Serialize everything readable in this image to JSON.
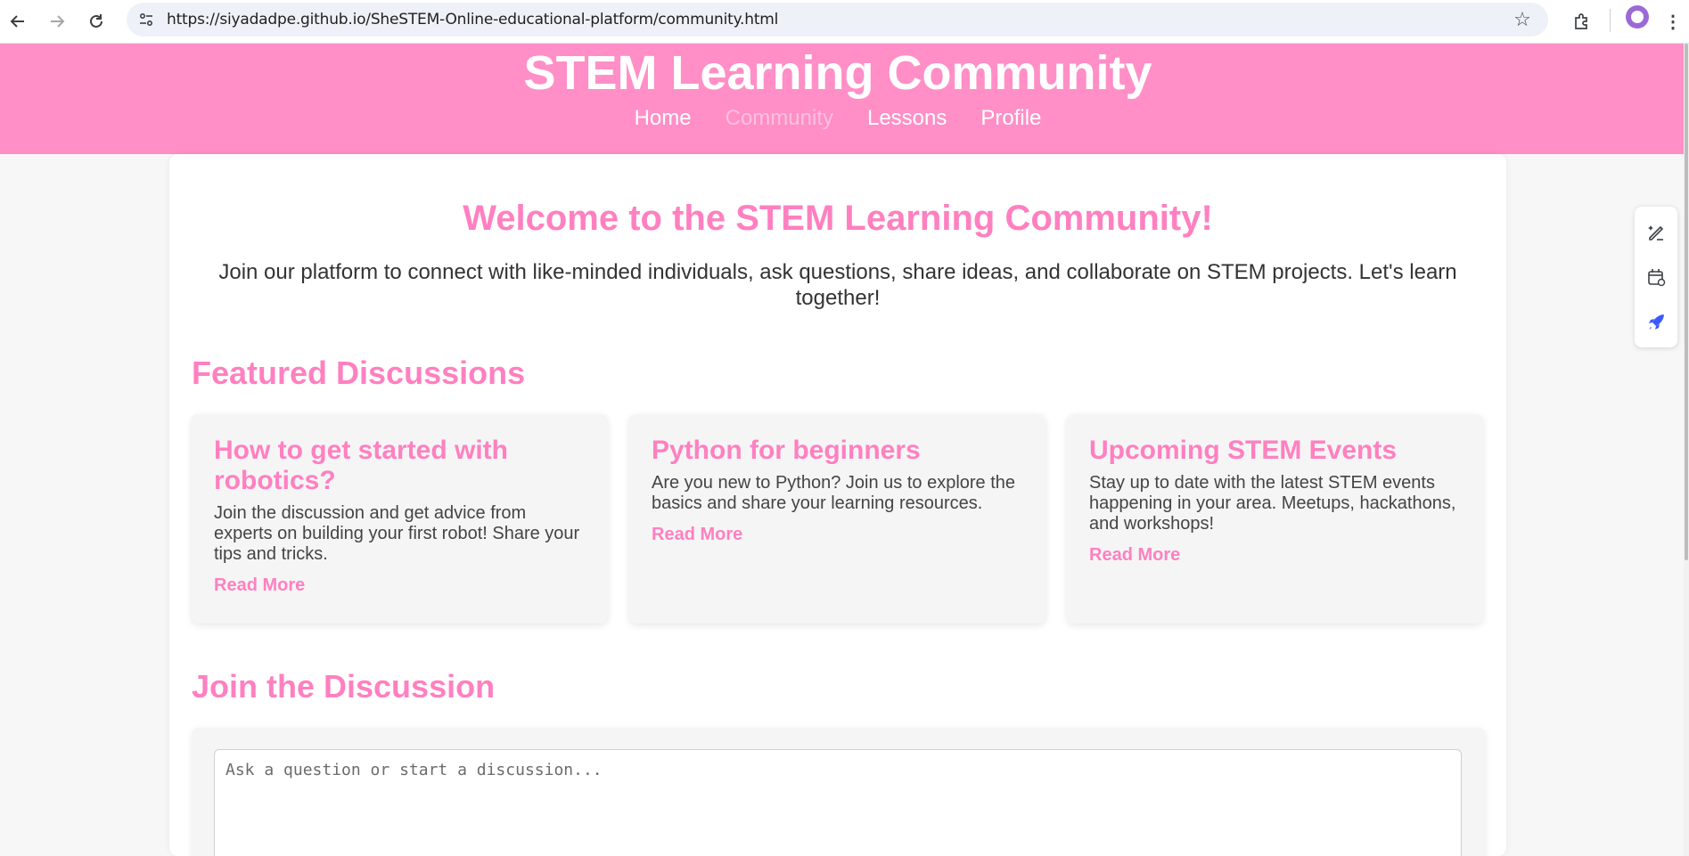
{
  "browser": {
    "url": "https://siyadadpe.github.io/SheSTEM-Online-educational-platform/community.html",
    "icons": [
      "back-arrow-icon",
      "forward-arrow-icon",
      "reload-icon",
      "site-info-icon",
      "bookmark-star-icon",
      "extensions-icon",
      "profile-avatar-icon",
      "more-menu-icon"
    ]
  },
  "header": {
    "title": "STEM Learning Community",
    "nav": [
      {
        "label": "Home",
        "active": false
      },
      {
        "label": "Community",
        "active": true
      },
      {
        "label": "Lessons",
        "active": false
      },
      {
        "label": "Profile",
        "active": false
      }
    ],
    "color": "#ff8fc6"
  },
  "main": {
    "welcome_title": "Welcome to the STEM Learning Community!",
    "intro": "Join our platform to connect with like-minded individuals, ask questions, share ideas, and collaborate on STEM projects. Let's learn together!",
    "featured_title": "Featured Discussions",
    "cards": [
      {
        "title": "How to get started with robotics?",
        "body": "Join the discussion and get advice from experts on building your first robot! Share your tips and tricks.",
        "link": "Read More"
      },
      {
        "title": "Python for beginners",
        "body": "Are you new to Python? Join us to explore the basics and share your learning resources.",
        "link": "Read More"
      },
      {
        "title": "Upcoming STEM Events",
        "body": "Stay up to date with the latest STEM events happening in your area. Meetups, hackathons, and workshops!",
        "link": "Read More"
      }
    ],
    "join_title": "Join the Discussion",
    "discussion_placeholder": "Ask a question or start a discussion...",
    "accent_color": "#ff80c0"
  },
  "floating_toolbar": {
    "icons": [
      "edit-sparkle-icon",
      "calendar-check-icon",
      "rocket-icon"
    ]
  }
}
